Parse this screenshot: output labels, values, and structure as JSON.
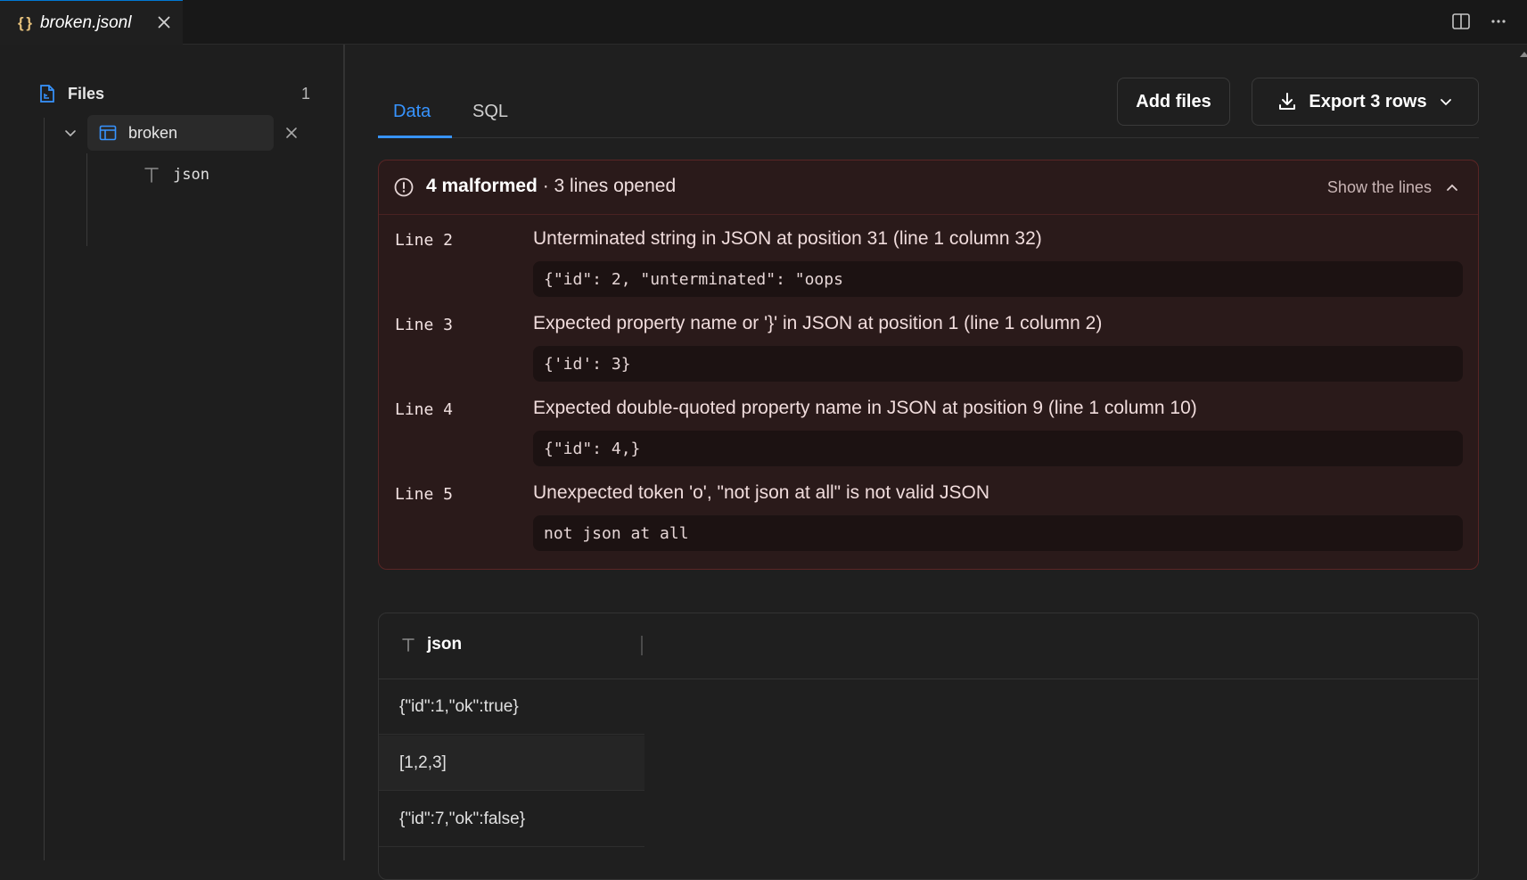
{
  "editor_tab": {
    "icon": "{ }",
    "title": "broken.jsonl"
  },
  "sidebar": {
    "files_label": "Files",
    "files_count": "1",
    "table_name": "broken",
    "column_name": "json"
  },
  "view_tabs": [
    {
      "label": "Data",
      "active": true
    },
    {
      "label": "SQL",
      "active": false
    }
  ],
  "actions": {
    "add_files": "Add files",
    "export": "Export 3 rows"
  },
  "errors": {
    "summary_bold": "4 malformed",
    "summary_rest": " · 3 lines opened",
    "toggle_label": "Show the lines",
    "items": [
      {
        "line": "Line 2",
        "message": "Unterminated string in JSON at position 31 (line 1 column 32)",
        "code": "{\"id\": 2, \"unterminated\": \"oops"
      },
      {
        "line": "Line 3",
        "message": "Expected property name or '}' in JSON at position 1 (line 1 column 2)",
        "code": "{'id': 3}"
      },
      {
        "line": "Line 4",
        "message": "Expected double-quoted property name in JSON at position 9 (line 1 column 10)",
        "code": "{\"id\": 4,}"
      },
      {
        "line": "Line 5",
        "message": "Unexpected token 'o', \"not json at all\" is not valid JSON",
        "code": "not json at all"
      }
    ]
  },
  "grid": {
    "column": "json",
    "rows": [
      "{\"id\":1,\"ok\":true}",
      "[1,2,3]",
      "{\"id\":7,\"ok\":false}"
    ]
  },
  "colors": {
    "accent": "#3794ff",
    "error_bg": "#2a1a1a",
    "error_border": "#5a2525",
    "json_icon": "#e5c07b"
  }
}
